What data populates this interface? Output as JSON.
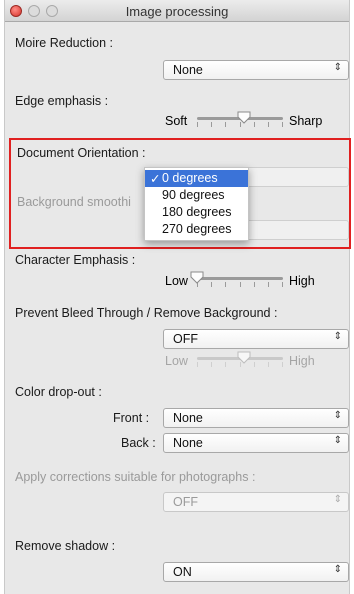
{
  "window": {
    "title": "Image processing"
  },
  "moire": {
    "label": "Moire Reduction :",
    "value": "None"
  },
  "edge": {
    "label": "Edge emphasis :",
    "low": "Soft",
    "high": "Sharp",
    "level": 0.55
  },
  "orientation": {
    "label": "Document Orientation :",
    "options": [
      "0 degrees",
      "90 degrees",
      "180 degrees",
      "270 degrees"
    ],
    "selected_index": 0,
    "check": "✓"
  },
  "background_smoothing": {
    "label": "Background smoothi"
  },
  "character": {
    "label": "Character Emphasis :",
    "low": "Low",
    "high": "High",
    "level": 0.0
  },
  "bleed": {
    "label": "Prevent Bleed Through / Remove Background :",
    "value": "OFF",
    "low": "Low",
    "high": "High",
    "level": 0.55
  },
  "color_dropout": {
    "label": "Color drop-out :",
    "front_label": "Front :",
    "front_value": "None",
    "back_label": "Back :",
    "back_value": "None"
  },
  "photo": {
    "label": "Apply corrections suitable for photographs :",
    "value": "OFF"
  },
  "shadow": {
    "label": "Remove shadow :",
    "value": "ON"
  },
  "icons": {
    "select_arrow": "⇕"
  }
}
